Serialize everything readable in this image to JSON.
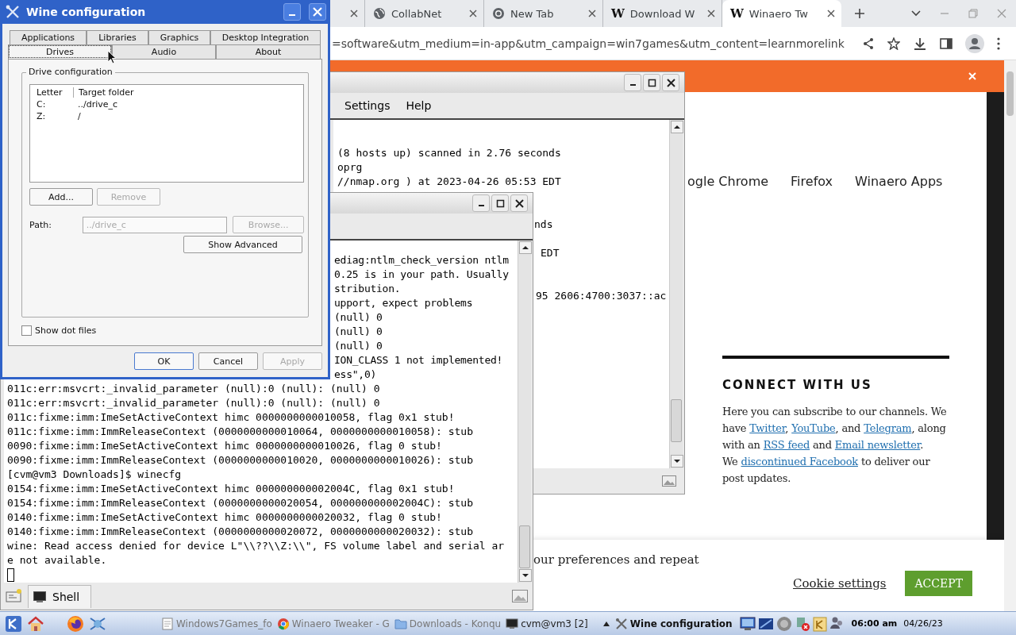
{
  "browser": {
    "tabs": [
      {
        "selected": false
      },
      {
        "title": "CollabNet",
        "selected": false
      },
      {
        "title": "New Tab",
        "selected": false
      },
      {
        "favicon_text": "W",
        "title": "Download W",
        "selected": false
      },
      {
        "favicon_text": "W",
        "title": "Winaero Tw",
        "selected": true
      }
    ],
    "address": "=software&utm_medium=in-app&utm_campaign=win7games&utm_content=learnmorelink",
    "nav": [
      "ogle Chrome",
      "Firefox",
      "Winaero Apps"
    ],
    "connect": {
      "heading": "CONNECT WITH US",
      "paragraphs": [
        [
          {
            "kind": "text",
            "text": "Here you can subscribe to our channels. We have "
          },
          {
            "kind": "link",
            "text": "Twitter"
          },
          {
            "kind": "text",
            "text": ", "
          },
          {
            "kind": "link",
            "text": "YouTube"
          },
          {
            "kind": "text",
            "text": ", and "
          },
          {
            "kind": "link",
            "text": "Telegram"
          },
          {
            "kind": "text",
            "text": ", along with an "
          },
          {
            "kind": "link",
            "text": "RSS feed"
          },
          {
            "kind": "text",
            "text": " and "
          },
          {
            "kind": "link",
            "text": "Email newsletter"
          },
          {
            "kind": "text",
            "text": "."
          }
        ],
        [
          {
            "kind": "text",
            "text": "We "
          },
          {
            "kind": "link",
            "text": "discontinued Facebook"
          },
          {
            "kind": "text",
            "text": " to deliver our post updates."
          }
        ]
      ]
    },
    "cookie_bar": {
      "text": "our preferences and repeat",
      "settings": "Cookie settings",
      "accept": "ACCEPT"
    }
  },
  "konsole_back": {
    "menu": [
      "Settings",
      "Help"
    ],
    "lines": [
      "(8 hosts up) scanned in 2.76 seconds",
      "oprg",
      "//nmap.org ) at 2023-04-26 05:53 EDT"
    ],
    "fragments": [
      "nds",
      "EDT",
      "95 2606:4700:3037::ac"
    ]
  },
  "konsole_front": {
    "fragments": [
      "ediag:ntlm_check_version ntlm",
      "0.25 is in your path. Usually",
      "stribution.",
      "upport, expect problems",
      "(null) 0",
      "(null) 0",
      "(null) 0",
      "ION_CLASS 1 not implemented!",
      "ess\",0)"
    ],
    "lines": [
      "011c:err:msvcrt:_invalid_parameter (null):0 (null): (null) 0",
      "011c:err:msvcrt:_invalid_parameter (null):0 (null): (null) 0",
      "011c:fixme:imm:ImeSetActiveContext himc 0000000000010058, flag 0x1 stub!",
      "011c:fixme:imm:ImmReleaseContext (0000000000010064, 0000000000010058): stub",
      "0090:fixme:imm:ImeSetActiveContext himc 0000000000010026, flag 0 stub!",
      "0090:fixme:imm:ImmReleaseContext (0000000000010020, 0000000000010026): stub",
      "[cvm@vm3 Downloads]$ winecfg",
      "0154:fixme:imm:ImeSetActiveContext himc 000000000002004C, flag 0x1 stub!",
      "0154:fixme:imm:ImmReleaseContext (0000000000020054, 000000000002004C): stub",
      "0140:fixme:imm:ImeSetActiveContext himc 0000000000020032, flag 0 stub!",
      "0140:fixme:imm:ImmReleaseContext (0000000000020072, 0000000000020032): stub",
      "wine: Read access denied for device L\"\\\\??\\\\Z:\\\\\", FS volume label and serial ar",
      "e not available."
    ],
    "tab": "Shell"
  },
  "winecfg": {
    "title": "Wine configuration",
    "tab_rows": [
      [
        {
          "label": "Applications",
          "selected": false
        },
        {
          "label": "Libraries",
          "selected": false
        },
        {
          "label": "Graphics",
          "selected": false
        },
        {
          "label": "Desktop Integration",
          "selected": false
        }
      ],
      [
        {
          "label": "Drives",
          "selected": true
        },
        {
          "label": "Audio",
          "selected": false
        },
        {
          "label": "About",
          "selected": false
        }
      ]
    ],
    "group": "Drive configuration",
    "columns": [
      "Letter",
      "Target folder"
    ],
    "drives": [
      {
        "letter": "C:",
        "target": "../drive_c"
      },
      {
        "letter": "Z:",
        "target": "/"
      }
    ],
    "list_buttons": [
      {
        "label": "Add...",
        "disabled": false
      },
      {
        "label": "Remove",
        "disabled": true
      }
    ],
    "path": {
      "label": "Path:",
      "value": "../drive_c",
      "disabled": true
    },
    "browse": {
      "label": "Browse...",
      "disabled": true
    },
    "advanced": {
      "label": "Show Advanced",
      "disabled": false
    },
    "show_dot_files": {
      "label": "Show dot files",
      "checked": false
    },
    "buttons": [
      {
        "label": "OK",
        "disabled": false,
        "default": true
      },
      {
        "label": "Cancel",
        "disabled": false,
        "default": false
      },
      {
        "label": "Apply",
        "disabled": true,
        "default": false
      }
    ]
  },
  "taskbar": {
    "tasks": [
      {
        "label": "Windows7Games_fo",
        "minimized": true,
        "active": false
      },
      {
        "label": "Winaero Tweaker - G",
        "minimized": true,
        "active": false
      },
      {
        "label": "Downloads - Konqu",
        "minimized": true,
        "active": false
      },
      {
        "label": "cvm@vm3 [2]",
        "minimized": false,
        "active": false
      },
      {
        "label": "Wine configuration",
        "minimized": false,
        "active": true
      }
    ],
    "time": "06:00 am",
    "date": "04/26/23"
  }
}
